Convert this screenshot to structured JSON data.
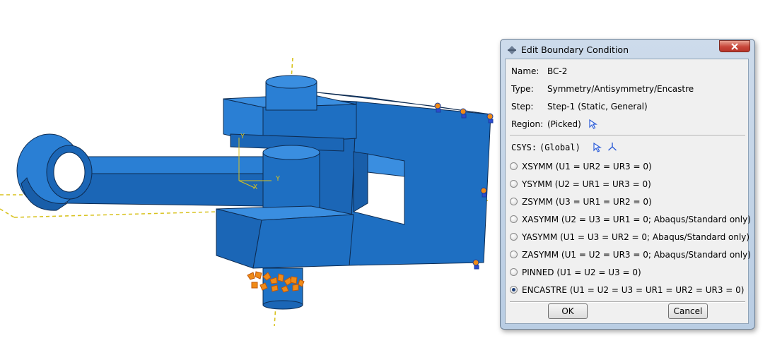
{
  "viewport": {
    "triad_labels": {
      "y_top": "Y",
      "x_bottom": "X",
      "y_right": "Y"
    },
    "colors": {
      "part": "#1f73c7",
      "part_edge": "#0e2c52",
      "axis": "#d8c21e",
      "bc_marker": "#f08a16"
    }
  },
  "dialog": {
    "title": "Edit Boundary Condition",
    "name_label": "Name:",
    "name_value": "BC-2",
    "type_label": "Type:",
    "type_value": "Symmetry/Antisymmetry/Encastre",
    "step_label": "Step:",
    "step_value": "Step-1 (Static, General)",
    "region_label": "Region:",
    "region_value": "(Picked)",
    "csys_label": "CSYS:",
    "csys_value": "(Global)",
    "options": [
      {
        "label": "XSYMM (U1 = UR2 = UR3 = 0)",
        "selected": false
      },
      {
        "label": "YSYMM (U2 = UR1 = UR3 = 0)",
        "selected": false
      },
      {
        "label": "ZSYMM (U3 = UR1 = UR2 = 0)",
        "selected": false
      },
      {
        "label": "XASYMM (U2 = U3 = UR1 = 0; Abaqus/Standard only)",
        "selected": false
      },
      {
        "label": "YASYMM (U1 = U3 = UR2 = 0; Abaqus/Standard only)",
        "selected": false
      },
      {
        "label": "ZASYMM (U1 = U2 = UR3 = 0; Abaqus/Standard only)",
        "selected": false
      },
      {
        "label": "PINNED (U1 = U2 = U3 = 0)",
        "selected": false
      },
      {
        "label": "ENCASTRE (U1 = U2 = U3 = UR1 = UR2 = UR3 = 0)",
        "selected": true
      }
    ],
    "ok_label": "OK",
    "cancel_label": "Cancel"
  }
}
